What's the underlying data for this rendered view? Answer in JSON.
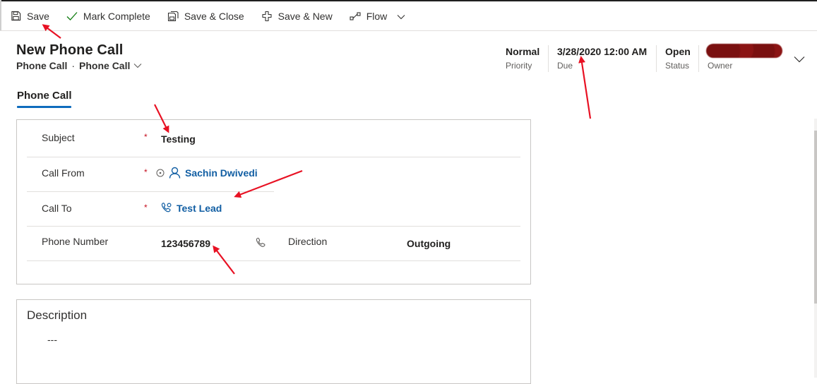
{
  "toolbar": {
    "save": "Save",
    "mark_complete": "Mark Complete",
    "save_close": "Save & Close",
    "save_new": "Save & New",
    "flow": "Flow"
  },
  "header": {
    "title": "New Phone Call",
    "entity": "Phone Call",
    "form": "Phone Call",
    "priority": {
      "value": "Normal",
      "label": "Priority"
    },
    "due": {
      "value": "3/28/2020 12:00 AM",
      "label": "Due"
    },
    "status": {
      "value": "Open",
      "label": "Status"
    },
    "owner": {
      "label": "Owner"
    }
  },
  "tab": {
    "label": "Phone Call"
  },
  "form": {
    "subject": {
      "label": "Subject",
      "value": "Testing"
    },
    "call_from": {
      "label": "Call From",
      "value": "Sachin Dwivedi"
    },
    "call_to": {
      "label": "Call To",
      "value": "Test Lead"
    },
    "phone_number": {
      "label": "Phone Number",
      "value": "123456789"
    },
    "direction": {
      "label": "Direction",
      "value": "Outgoing"
    },
    "required_mark": "*"
  },
  "description": {
    "label": "Description",
    "value": "---"
  },
  "colors": {
    "accent": "#0f6cbd",
    "link": "#115ea3",
    "required": "#c50f1f",
    "annotation": "#e81123"
  }
}
